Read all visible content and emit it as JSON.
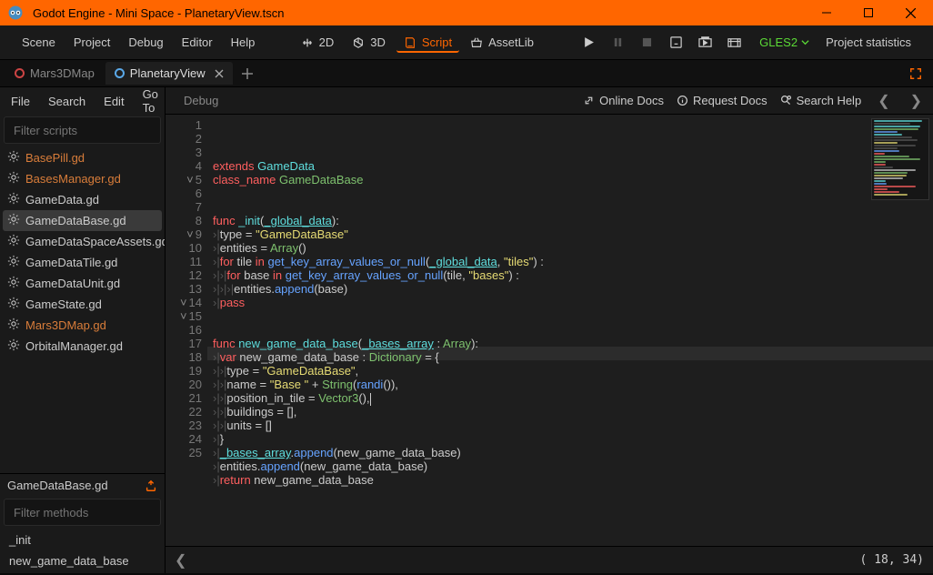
{
  "window": {
    "title": "Godot Engine - Mini Space - PlanetaryView.tscn"
  },
  "menubar": {
    "items": [
      "Scene",
      "Project",
      "Debug",
      "Editor",
      "Help"
    ]
  },
  "modes": {
    "d2": "2D",
    "d3": "3D",
    "script": "Script",
    "assetlib": "AssetLib"
  },
  "renderer": "GLES2",
  "proj_stats": "Project statistics",
  "tabs": [
    {
      "label": "Mars3DMap",
      "active": false
    },
    {
      "label": "PlanetaryView",
      "active": true
    }
  ],
  "sidebar_menu": [
    "File",
    "Search",
    "Edit",
    "Go To"
  ],
  "debug_label": "Debug",
  "filter_scripts_placeholder": "Filter scripts",
  "filter_methods_placeholder": "Filter methods",
  "scripts": [
    {
      "name": "BasePill.gd",
      "orange": true
    },
    {
      "name": "BasesManager.gd",
      "orange": true
    },
    {
      "name": "GameData.gd"
    },
    {
      "name": "GameDataBase.gd",
      "selected": true
    },
    {
      "name": "GameDataSpaceAssets.gd"
    },
    {
      "name": "GameDataTile.gd"
    },
    {
      "name": "GameDataUnit.gd"
    },
    {
      "name": "GameState.gd"
    },
    {
      "name": "Mars3DMap.gd",
      "orange": true
    },
    {
      "name": "OrbitalManager.gd"
    }
  ],
  "current_script": "GameDataBase.gd",
  "methods": [
    "_init",
    "new_game_data_base"
  ],
  "toolbar_links": {
    "online": "Online Docs",
    "request": "Request Docs",
    "search": "Search Help"
  },
  "status": {
    "pos": "( 18, 34)"
  },
  "code_lines": [
    {
      "n": 1,
      "seg": [
        [
          "kw-red",
          "extends "
        ],
        [
          "kw-cyan",
          "GameData"
        ]
      ]
    },
    {
      "n": 2,
      "seg": [
        [
          "kw-red",
          "class_name "
        ],
        [
          "kw-green",
          "GameDataBase"
        ]
      ]
    },
    {
      "n": 3,
      "seg": []
    },
    {
      "n": 4,
      "seg": []
    },
    {
      "n": 5,
      "fold": "v",
      "seg": [
        [
          "kw-red",
          "func "
        ],
        [
          "kw-cyan",
          "_init"
        ],
        [
          "",
          "("
        ],
        [
          "kw-cyan underline",
          "_global_data"
        ],
        [
          "",
          "):"
        ]
      ]
    },
    {
      "n": 6,
      "seg": [
        [
          "kw-dim",
          ">|"
        ],
        [
          "",
          "type = "
        ],
        [
          "kw-yellow",
          "\"GameDataBase\""
        ]
      ]
    },
    {
      "n": 7,
      "seg": [
        [
          "kw-dim",
          ">|"
        ],
        [
          "",
          "entities = "
        ],
        [
          "kw-green",
          "Array"
        ],
        [
          "",
          "()"
        ]
      ]
    },
    {
      "n": 8,
      "seg": [
        [
          "kw-dim",
          ">|"
        ],
        [
          "kw-red",
          "for "
        ],
        [
          "",
          "tile "
        ],
        [
          "kw-red",
          "in "
        ],
        [
          "kw-blue",
          "get_key_array_values_or_null"
        ],
        [
          "",
          "("
        ],
        [
          "kw-cyan underline",
          "_global_data"
        ],
        [
          "",
          ", "
        ],
        [
          "kw-yellow",
          "\"tiles\""
        ],
        [
          "",
          ") :"
        ]
      ]
    },
    {
      "n": 9,
      "fold": "v",
      "seg": [
        [
          "kw-dim",
          ">|>|"
        ],
        [
          "kw-red",
          "for "
        ],
        [
          "",
          "base "
        ],
        [
          "kw-red",
          "in "
        ],
        [
          "kw-blue",
          "get_key_array_values_or_null"
        ],
        [
          "",
          "(tile, "
        ],
        [
          "kw-yellow",
          "\"bases\""
        ],
        [
          "",
          ") :"
        ]
      ]
    },
    {
      "n": 10,
      "seg": [
        [
          "kw-dim",
          ">|>|>|"
        ],
        [
          "",
          "entities."
        ],
        [
          "kw-blue",
          "append"
        ],
        [
          "",
          "(base)"
        ]
      ]
    },
    {
      "n": 11,
      "seg": [
        [
          "kw-dim",
          ">|"
        ],
        [
          "kw-red",
          "pass"
        ]
      ]
    },
    {
      "n": 12,
      "seg": []
    },
    {
      "n": 13,
      "seg": []
    },
    {
      "n": 14,
      "fold": "v",
      "seg": [
        [
          "kw-red",
          "func "
        ],
        [
          "kw-cyan",
          "new_game_data_base"
        ],
        [
          "",
          "("
        ],
        [
          "kw-cyan underline",
          "_bases_array"
        ],
        [
          "",
          " : "
        ],
        [
          "kw-green",
          "Array"
        ],
        [
          "",
          "):"
        ]
      ]
    },
    {
      "n": 15,
      "fold": "v",
      "seg": [
        [
          "kw-dim",
          ">|"
        ],
        [
          "kw-red",
          "var "
        ],
        [
          "",
          "new_game_data_base : "
        ],
        [
          "kw-green",
          "Dictionary"
        ],
        [
          "",
          " = {"
        ]
      ]
    },
    {
      "n": 16,
      "seg": [
        [
          "kw-dim",
          ">|>|"
        ],
        [
          "",
          "type = "
        ],
        [
          "kw-yellow",
          "\"GameDataBase\""
        ],
        [
          "",
          ","
        ]
      ]
    },
    {
      "n": 17,
      "seg": [
        [
          "kw-dim",
          ">|>|"
        ],
        [
          "",
          "name = "
        ],
        [
          "kw-yellow",
          "\"Base \""
        ],
        [
          "",
          " + "
        ],
        [
          "kw-green",
          "String"
        ],
        [
          "",
          "("
        ],
        [
          "kw-blue",
          "randi"
        ],
        [
          "",
          "()),"
        ]
      ]
    },
    {
      "n": 18,
      "seg": [
        [
          "kw-dim",
          ">|>|"
        ],
        [
          "",
          "position_in_tile = "
        ],
        [
          "kw-green",
          "Vector3"
        ],
        [
          "",
          "(),"
        ]
      ],
      "cursor": true
    },
    {
      "n": 19,
      "seg": [
        [
          "kw-dim",
          ">|>|"
        ],
        [
          "",
          "buildings = [],"
        ]
      ]
    },
    {
      "n": 20,
      "seg": [
        [
          "kw-dim",
          ">|>|"
        ],
        [
          "",
          "units = []"
        ]
      ]
    },
    {
      "n": 21,
      "seg": [
        [
          "kw-dim",
          ">|"
        ],
        [
          "",
          "}"
        ]
      ]
    },
    {
      "n": 22,
      "seg": [
        [
          "kw-dim",
          ">|"
        ],
        [
          "kw-cyan underline",
          "_bases_array"
        ],
        [
          "",
          "."
        ],
        [
          "kw-blue",
          "append"
        ],
        [
          "",
          "(new_game_data_base)"
        ]
      ]
    },
    {
      "n": 23,
      "seg": [
        [
          "kw-dim",
          ">|"
        ],
        [
          "",
          "entities."
        ],
        [
          "kw-blue",
          "append"
        ],
        [
          "",
          "(new_game_data_base)"
        ]
      ]
    },
    {
      "n": 24,
      "seg": [
        [
          "kw-dim",
          ">|"
        ],
        [
          "kw-red",
          "return "
        ],
        [
          "",
          "new_game_data_base"
        ]
      ]
    },
    {
      "n": 25,
      "seg": []
    }
  ]
}
